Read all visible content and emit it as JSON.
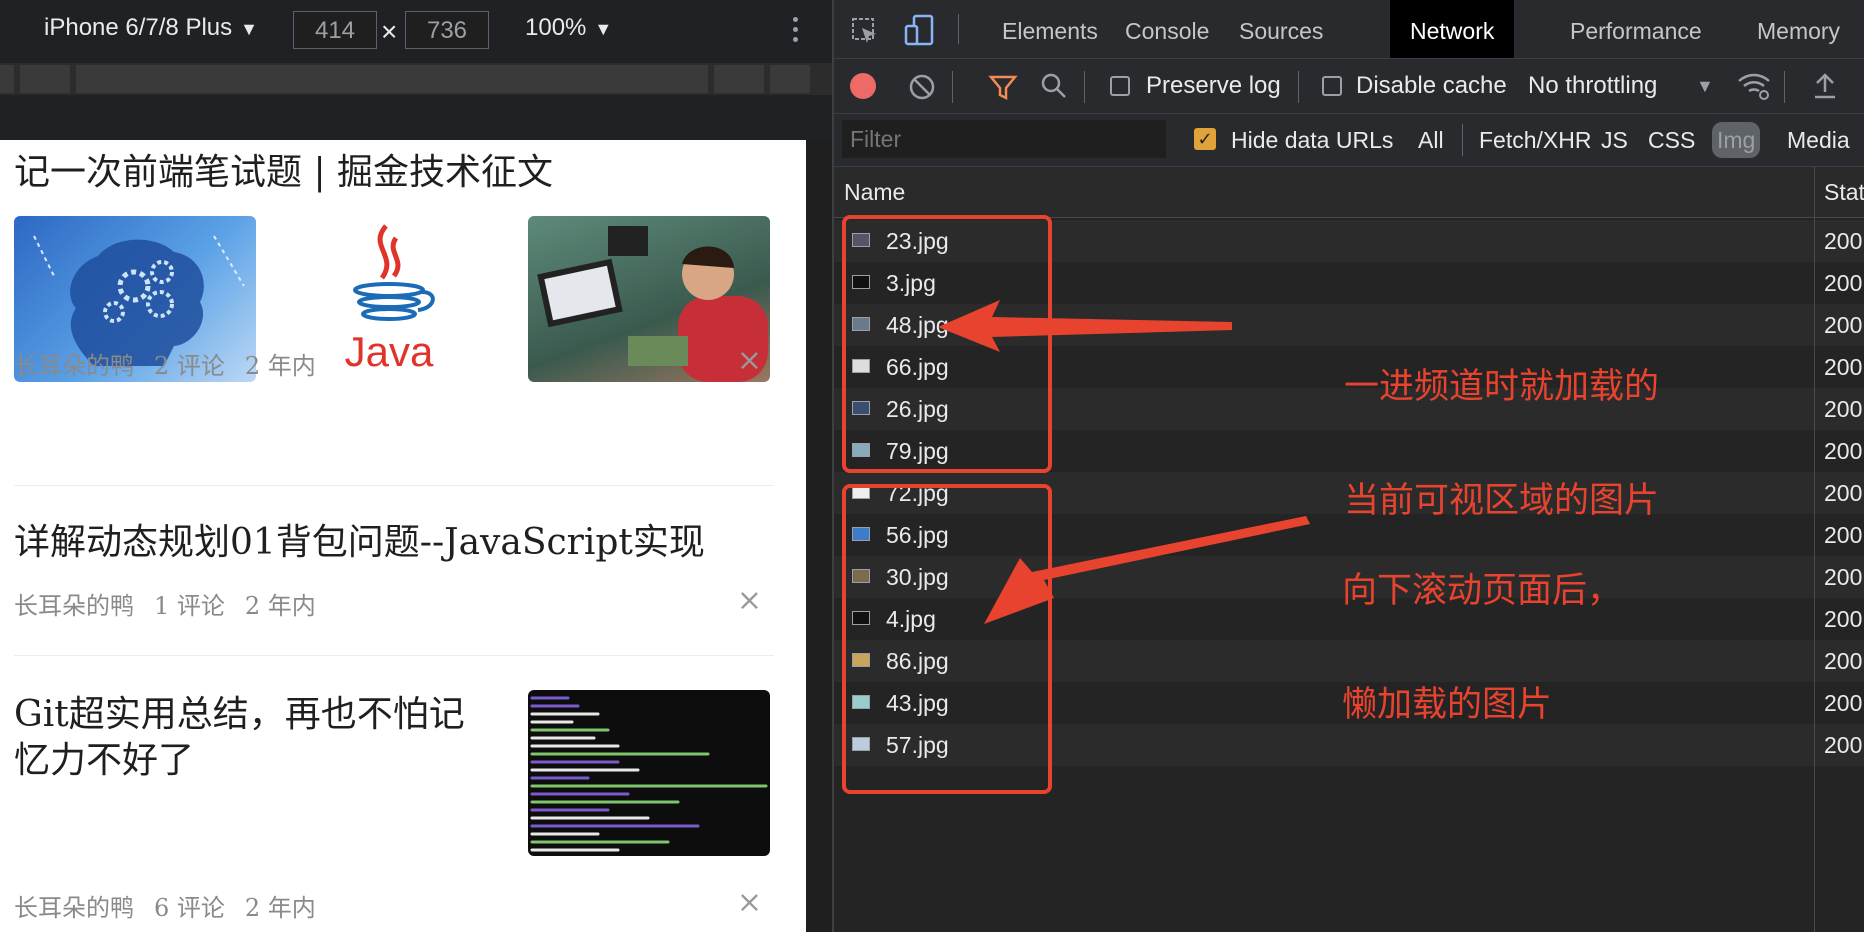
{
  "device_toolbar": {
    "device": "iPhone 6/7/8 Plus",
    "width": "414",
    "height": "736",
    "dim_separator": "×",
    "zoom": "100%"
  },
  "page": {
    "articles": [
      {
        "title": "记一次前端笔试题 | 掘金技术征文",
        "author": "长耳朵的鸭",
        "comments": "2 评论",
        "time": "2 年内",
        "thumbs": [
          "brain-gears",
          "java-logo",
          "kids-laptops"
        ]
      },
      {
        "title": "详解动态规划01背包问题--JavaScript实现",
        "author": "长耳朵的鸭",
        "comments": "1 评论",
        "time": "2 年内",
        "thumbs": []
      },
      {
        "title_line1": "Git超实用总结，再也不怕记",
        "title_line2": "忆力不好了",
        "author": "长耳朵的鸭",
        "comments": "6 评论",
        "time": "2 年内",
        "thumbs": [
          "code-screenshot"
        ]
      }
    ],
    "java_logo_text": "Java",
    "close_glyph": "×"
  },
  "devtools": {
    "tabs": [
      "Elements",
      "Console",
      "Sources",
      "Network",
      "Performance",
      "Memory"
    ],
    "active_tab": "Network",
    "toolbar": {
      "preserve_log": "Preserve log",
      "disable_cache": "Disable cache",
      "throttling": "No throttling"
    },
    "filter": {
      "placeholder": "Filter",
      "hide_data_urls": "Hide data URLs",
      "types": [
        "All",
        "Fetch/XHR",
        "JS",
        "CSS",
        "Img",
        "Media"
      ],
      "active_type": "Img"
    },
    "table": {
      "columns": [
        "Name",
        "Stat"
      ],
      "rows": [
        {
          "name": "23.jpg",
          "status": "200"
        },
        {
          "name": "3.jpg",
          "status": "200"
        },
        {
          "name": "48.jpg",
          "status": "200"
        },
        {
          "name": "66.jpg",
          "status": "200"
        },
        {
          "name": "26.jpg",
          "status": "200"
        },
        {
          "name": "79.jpg",
          "status": "200"
        },
        {
          "name": "72.jpg",
          "status": "200"
        },
        {
          "name": "56.jpg",
          "status": "200"
        },
        {
          "name": "30.jpg",
          "status": "200"
        },
        {
          "name": "4.jpg",
          "status": "200"
        },
        {
          "name": "86.jpg",
          "status": "200"
        },
        {
          "name": "43.jpg",
          "status": "200"
        },
        {
          "name": "57.jpg",
          "status": "200"
        }
      ]
    }
  },
  "annotations": {
    "first": {
      "line1": "一进频道时就加载的",
      "line2": "当前可视区域的图片"
    },
    "second": {
      "line1": "向下滚动页面后，",
      "line2": "懒加载的图片"
    },
    "color": "#e8432e"
  },
  "colors": {
    "accent_checkbox": "#e0a23a",
    "record": "#ee6a66",
    "filter_icon": "#f28b54"
  }
}
